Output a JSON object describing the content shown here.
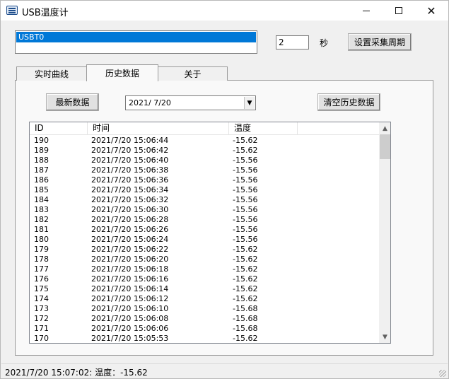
{
  "window": {
    "title": "USB温度计",
    "minimize_icon": "minimize-icon",
    "maximize_icon": "maximize-icon",
    "close_icon": "close-icon",
    "close_glyph": "✕"
  },
  "device": {
    "items": [
      "USBT0"
    ]
  },
  "period": {
    "value": "2",
    "unit_label": "秒",
    "set_button_label": "设置采集周期"
  },
  "tabs": [
    {
      "label": "实时曲线"
    },
    {
      "label": "历史数据",
      "selected": true
    },
    {
      "label": "关于"
    }
  ],
  "history": {
    "latest_button_label": "最新数据",
    "date_value": "2021/  7/20",
    "date_drop_glyph": "▼",
    "clear_button_label": "清空历史数据",
    "columns": [
      "ID",
      "时间",
      "温度"
    ],
    "rows": [
      {
        "id": "190",
        "time": "2021/7/20 15:06:44",
        "temp": "-15.62"
      },
      {
        "id": "189",
        "time": "2021/7/20 15:06:42",
        "temp": "-15.62"
      },
      {
        "id": "188",
        "time": "2021/7/20 15:06:40",
        "temp": "-15.56"
      },
      {
        "id": "187",
        "time": "2021/7/20 15:06:38",
        "temp": "-15.56"
      },
      {
        "id": "186",
        "time": "2021/7/20 15:06:36",
        "temp": "-15.56"
      },
      {
        "id": "185",
        "time": "2021/7/20 15:06:34",
        "temp": "-15.56"
      },
      {
        "id": "184",
        "time": "2021/7/20 15:06:32",
        "temp": "-15.56"
      },
      {
        "id": "183",
        "time": "2021/7/20 15:06:30",
        "temp": "-15.56"
      },
      {
        "id": "182",
        "time": "2021/7/20 15:06:28",
        "temp": "-15.56"
      },
      {
        "id": "181",
        "time": "2021/7/20 15:06:26",
        "temp": "-15.56"
      },
      {
        "id": "180",
        "time": "2021/7/20 15:06:24",
        "temp": "-15.56"
      },
      {
        "id": "179",
        "time": "2021/7/20 15:06:22",
        "temp": "-15.62"
      },
      {
        "id": "178",
        "time": "2021/7/20 15:06:20",
        "temp": "-15.62"
      },
      {
        "id": "177",
        "time": "2021/7/20 15:06:18",
        "temp": "-15.62"
      },
      {
        "id": "176",
        "time": "2021/7/20 15:06:16",
        "temp": "-15.62"
      },
      {
        "id": "175",
        "time": "2021/7/20 15:06:14",
        "temp": "-15.62"
      },
      {
        "id": "174",
        "time": "2021/7/20 15:06:12",
        "temp": "-15.62"
      },
      {
        "id": "173",
        "time": "2021/7/20 15:06:10",
        "temp": "-15.68"
      },
      {
        "id": "172",
        "time": "2021/7/20 15:06:08",
        "temp": "-15.68"
      },
      {
        "id": "171",
        "time": "2021/7/20 15:06:06",
        "temp": "-15.68"
      },
      {
        "id": "170",
        "time": "2021/7/20 15:05:53",
        "temp": "-15.62"
      }
    ],
    "scroll_up_glyph": "▲",
    "scroll_down_glyph": "▼"
  },
  "status": {
    "text": "2021/7/20 15:07:02: 温度：-15.62"
  }
}
